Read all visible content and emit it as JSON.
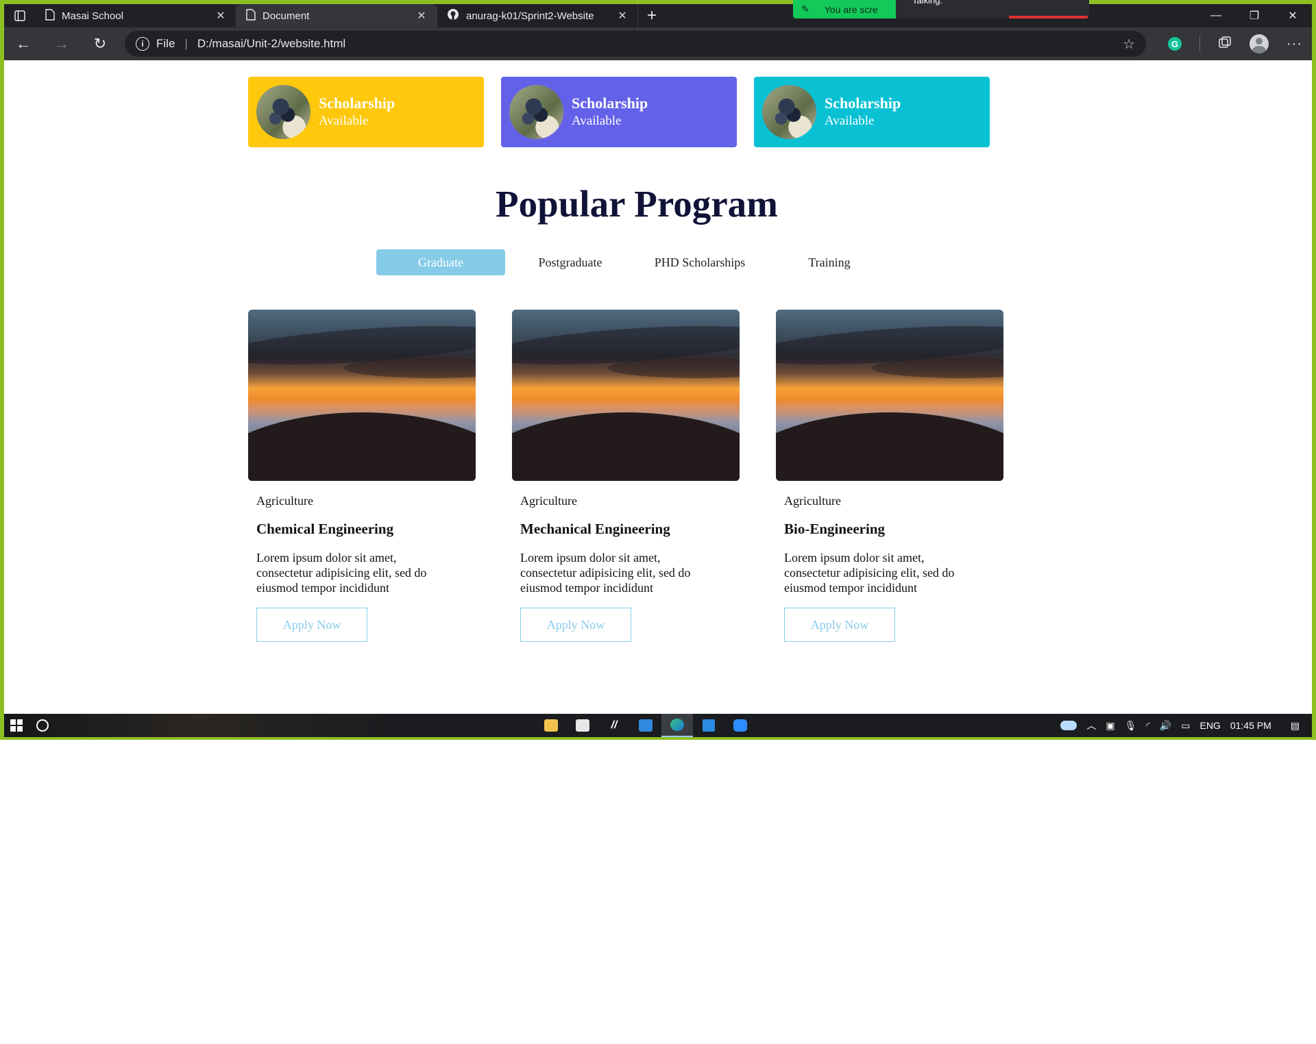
{
  "browser": {
    "tabs": [
      {
        "title": "Masai School",
        "icon": "page-icon",
        "active": false
      },
      {
        "title": "Document",
        "icon": "page-icon",
        "active": true
      },
      {
        "title": "anurag-k01/Sprint2-Website",
        "icon": "github-icon",
        "active": false
      }
    ],
    "share_indicator": {
      "text": "You are scre",
      "popup_text": "Talking:"
    },
    "address": {
      "scheme_label": "File",
      "url": "D:/masai/Unit-2/website.html"
    }
  },
  "page": {
    "scholarships": [
      {
        "title": "Scholarship",
        "subtitle": "Available",
        "color": "#fec80c"
      },
      {
        "title": "Scholarship",
        "subtitle": "Available",
        "color": "#6461e9"
      },
      {
        "title": "Scholarship",
        "subtitle": "Available",
        "color": "#0ac1d4"
      }
    ],
    "section_title": "Popular Program",
    "program_tabs": [
      {
        "label": "Graduate",
        "active": true
      },
      {
        "label": "Postgraduate",
        "active": false
      },
      {
        "label": "PHD Scholarships",
        "active": false
      },
      {
        "label": "Training",
        "active": false
      }
    ],
    "programs": [
      {
        "category": "Agriculture",
        "name": "Chemical Engineering",
        "description": "Lorem ipsum dolor sit amet, consectetur adipisicing elit, sed do eiusmod tempor incididunt",
        "button": "Apply Now"
      },
      {
        "category": "Agriculture",
        "name": "Mechanical Engineering",
        "description": "Lorem ipsum dolor sit amet, consectetur adipisicing elit, sed do eiusmod tempor incididunt",
        "button": "Apply Now"
      },
      {
        "category": "Agriculture",
        "name": "Bio-Engineering",
        "description": "Lorem ipsum dolor sit amet, consectetur adipisicing elit, sed do eiusmod tempor incididunt",
        "button": "Apply Now"
      }
    ],
    "accent_color": "#86cbe8",
    "title_color": "#111238"
  },
  "taskbar": {
    "pinned_apps": [
      "file-explorer-icon",
      "store-icon",
      "ink-icon",
      "mail-icon",
      "edge-icon",
      "vscode-icon",
      "zoom-icon"
    ],
    "language": "ENG",
    "time": "01:45 PM"
  }
}
